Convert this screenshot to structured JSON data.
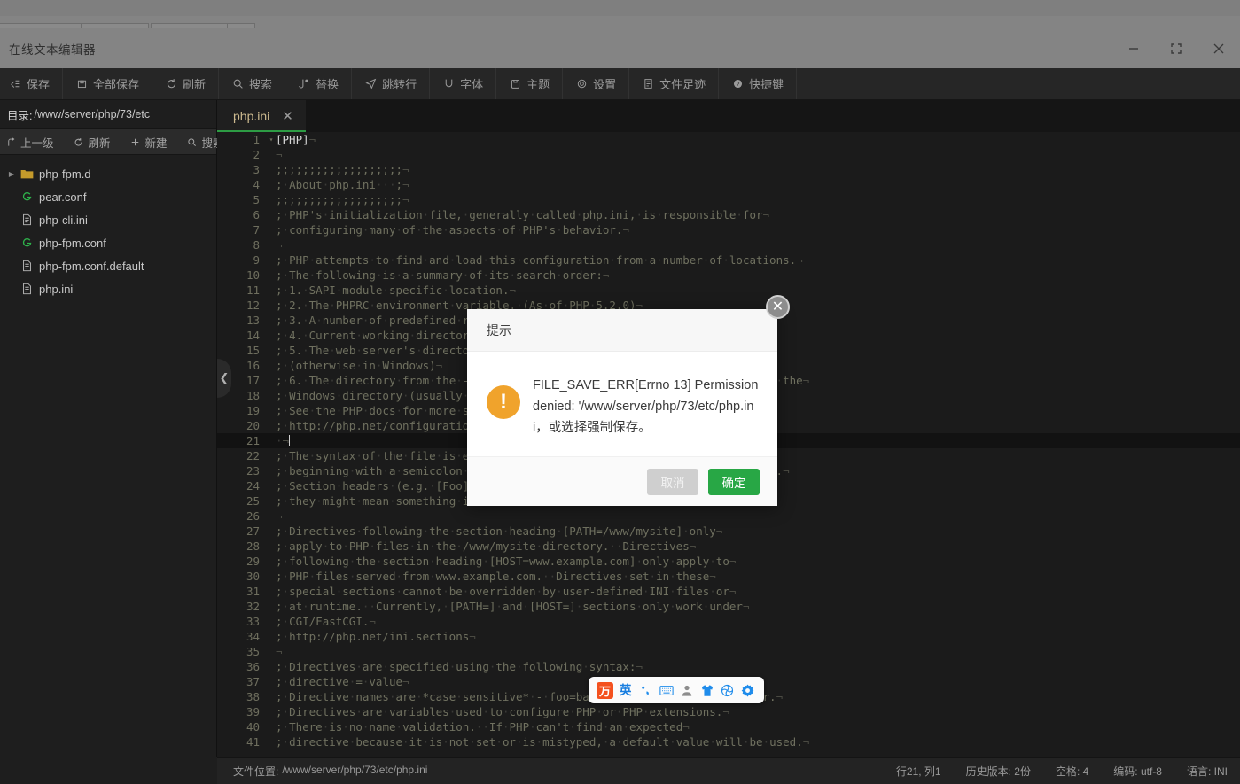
{
  "window": {
    "title": "在线文本编辑器",
    "controls": [
      {
        "name": "minimize",
        "icon": "minimize-icon"
      },
      {
        "name": "maximize",
        "icon": "maximize-icon"
      },
      {
        "name": "close",
        "icon": "close-icon"
      }
    ]
  },
  "toolbar": {
    "items": [
      {
        "label": "保存",
        "icon": "save-icon"
      },
      {
        "label": "全部保存",
        "icon": "save-all-icon"
      },
      {
        "label": "刷新",
        "icon": "refresh-icon"
      },
      {
        "label": "搜索",
        "icon": "search-icon"
      },
      {
        "label": "替换",
        "icon": "replace-icon"
      },
      {
        "label": "跳转行",
        "icon": "goto-line-icon"
      },
      {
        "label": "字体",
        "icon": "font-icon"
      },
      {
        "label": "主题",
        "icon": "theme-icon"
      },
      {
        "label": "设置",
        "icon": "gear-icon"
      },
      {
        "label": "文件足迹",
        "icon": "file-history-icon"
      },
      {
        "label": "快捷键",
        "icon": "shortcut-icon"
      }
    ]
  },
  "sidebar": {
    "dir_label": "目录:",
    "dir_path": "/www/server/php/73/etc",
    "tools": [
      {
        "label": "上一级",
        "icon": "up-level-icon"
      },
      {
        "label": "刷新",
        "icon": "refresh-icon"
      },
      {
        "label": "新建",
        "icon": "plus-icon"
      },
      {
        "label": "搜索",
        "icon": "search-icon"
      }
    ],
    "files": [
      {
        "name": "php-fpm.d",
        "type": "folder",
        "icon": "folder-icon",
        "expandable": true
      },
      {
        "name": "pear.conf",
        "type": "conf",
        "icon": "g-conf-icon",
        "expandable": false
      },
      {
        "name": "php-cli.ini",
        "type": "file",
        "icon": "file-icon",
        "expandable": false
      },
      {
        "name": "php-fpm.conf",
        "type": "conf",
        "icon": "g-conf-icon",
        "expandable": false
      },
      {
        "name": "php-fpm.conf.default",
        "type": "file",
        "icon": "file-icon",
        "expandable": false
      },
      {
        "name": "php.ini",
        "type": "file",
        "icon": "file-icon",
        "expandable": false
      }
    ],
    "collapse_handle_icon": "chevron-left-icon"
  },
  "editor": {
    "tabs": [
      {
        "label": "php.ini",
        "active": true,
        "close_icon": "close-icon"
      }
    ],
    "active_line": 21,
    "lines": [
      {
        "n": 1,
        "text": "[PHP]",
        "section": true,
        "fold": true
      },
      {
        "n": 2,
        "text": ""
      },
      {
        "n": 3,
        "text": ";;;;;;;;;;;;;;;;;;;"
      },
      {
        "n": 4,
        "text": "; About php.ini   ;"
      },
      {
        "n": 5,
        "text": ";;;;;;;;;;;;;;;;;;;"
      },
      {
        "n": 6,
        "text": "; PHP's initialization file, generally called php.ini, is responsible for"
      },
      {
        "n": 7,
        "text": "; configuring many of the aspects of PHP's behavior."
      },
      {
        "n": 8,
        "text": ""
      },
      {
        "n": 9,
        "text": "; PHP attempts to find and load this configuration from a number of locations."
      },
      {
        "n": 10,
        "text": "; The following is a summary of its search order:"
      },
      {
        "n": 11,
        "text": "; 1. SAPI module specific location."
      },
      {
        "n": 12,
        "text": "; 2. The PHPRC environment variable. (As of PHP 5.2.0)"
      },
      {
        "n": 13,
        "text": "; 3. A number of predefined registry keys on Windows (As of PHP 5.2.0)"
      },
      {
        "n": 14,
        "text": "; 4. Current working directory (except CLI)"
      },
      {
        "n": 15,
        "text": "; 5. The web server's directory (for SAPI modules), or directory of PHP"
      },
      {
        "n": 16,
        "text": "; (otherwise in Windows)"
      },
      {
        "n": 17,
        "text": "; 6. The directory from the --with-config-file-path compile time option, or the"
      },
      {
        "n": 18,
        "text": "; Windows directory (usually C:\\windows)"
      },
      {
        "n": 19,
        "text": "; See the PHP docs for more specific information."
      },
      {
        "n": 20,
        "text": "; http://php.net/configuration.file"
      },
      {
        "n": 21,
        "text": " ",
        "active": true,
        "caret": true
      },
      {
        "n": 22,
        "text": "; The syntax of the file is extremely simple.  Whitespace and lines"
      },
      {
        "n": 23,
        "text": "; beginning with a semicolon are silently ignored (as you probably guessed)."
      },
      {
        "n": 24,
        "text": "; Section headers (e.g. [Foo]) are also silently ignored, even though"
      },
      {
        "n": 25,
        "text": "; they might mean something in the future."
      },
      {
        "n": 26,
        "text": ""
      },
      {
        "n": 27,
        "text": "; Directives following the section heading [PATH=/www/mysite] only"
      },
      {
        "n": 28,
        "text": "; apply to PHP files in the /www/mysite directory.  Directives"
      },
      {
        "n": 29,
        "text": "; following the section heading [HOST=www.example.com] only apply to"
      },
      {
        "n": 30,
        "text": "; PHP files served from www.example.com.  Directives set in these"
      },
      {
        "n": 31,
        "text": "; special sections cannot be overridden by user-defined INI files or"
      },
      {
        "n": 32,
        "text": "; at runtime.  Currently, [PATH=] and [HOST=] sections only work under"
      },
      {
        "n": 33,
        "text": "; CGI/FastCGI."
      },
      {
        "n": 34,
        "text": "; http://php.net/ini.sections"
      },
      {
        "n": 35,
        "text": ""
      },
      {
        "n": 36,
        "text": "; Directives are specified using the following syntax:"
      },
      {
        "n": 37,
        "text": "; directive = value"
      },
      {
        "n": 38,
        "text": "; Directive names are *case sensitive* - foo=bar is different from FOO=bar."
      },
      {
        "n": 39,
        "text": "; Directives are variables used to configure PHP or PHP extensions."
      },
      {
        "n": 40,
        "text": "; There is no name validation.  If PHP can't find an expected"
      },
      {
        "n": 41,
        "text": "; directive because it is not set or is mistyped, a default value will be used."
      }
    ]
  },
  "statusbar": {
    "file_label": "文件位置:",
    "file_path": "/www/server/php/73/etc/php.ini",
    "cursor": "行21, 列1",
    "history": "历史版本: 2份",
    "indent": "空格: 4",
    "encoding": "编码: utf-8",
    "language": "语言: INI"
  },
  "dialog": {
    "title": "提示",
    "message": "FILE_SAVE_ERR[Errno 13] Permission denied: '/www/server/php/73/etc/php.ini，或选择强制保存。",
    "warn_icon": "warning-icon",
    "close_icon": "close-icon",
    "cancel_label": "取消",
    "confirm_label": "确定"
  },
  "ime": {
    "items": [
      {
        "name": "wubi-logo",
        "icon": "wubi-logo-icon",
        "label": "万"
      },
      {
        "name": "language-mode",
        "icon": "english-mode-icon",
        "label": "英"
      },
      {
        "name": "punctuation",
        "icon": "punctuation-icon"
      },
      {
        "name": "soft-keyboard",
        "icon": "keyboard-icon"
      },
      {
        "name": "user",
        "icon": "person-icon"
      },
      {
        "name": "skin",
        "icon": "shirt-icon"
      },
      {
        "name": "toolbox",
        "icon": "spiral-icon"
      },
      {
        "name": "settings",
        "icon": "gear-icon"
      }
    ]
  },
  "colors": {
    "accent_green": "#28a745",
    "warn_orange": "#f0a32c",
    "tab_text": "#cbb98e",
    "ime_blue": "#1f8ceb"
  }
}
